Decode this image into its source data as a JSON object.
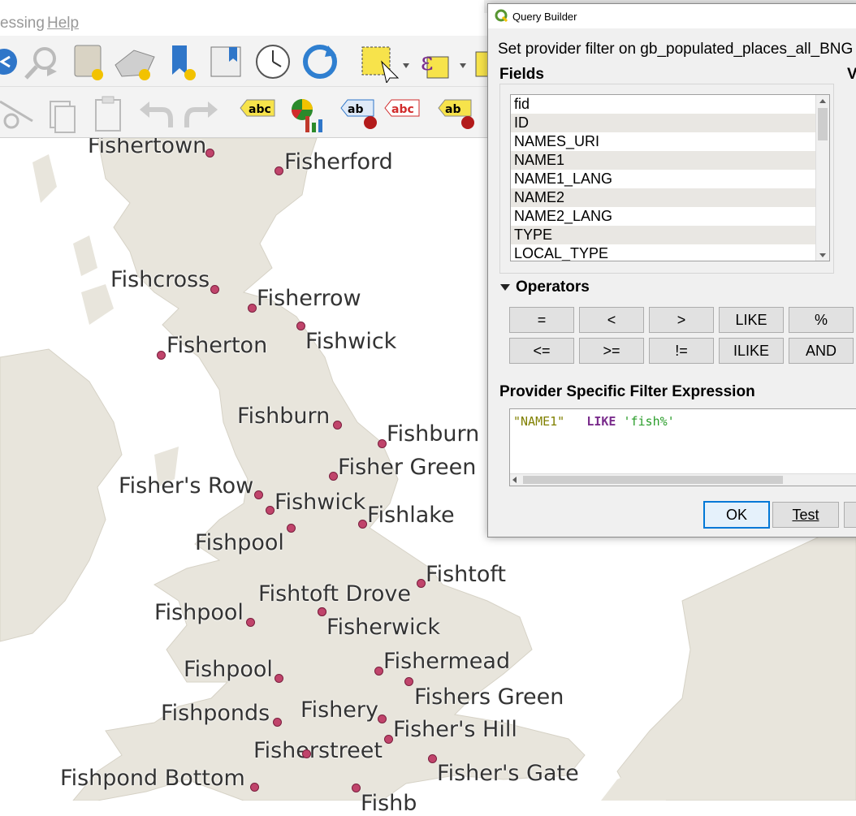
{
  "menubar": {
    "items": [
      "essing",
      "Help"
    ]
  },
  "toolbar1": {
    "icons": [
      "pan-back-icon",
      "zoom-next-icon",
      "new-layer-icon",
      "mesh-layer-icon",
      "bookmark-icon",
      "show-bookmarks-icon",
      "temporal-clock-icon",
      "refresh-icon",
      "select-features-icon",
      "expression-select-icon",
      "select-partial-icon"
    ]
  },
  "toolbar2": {
    "icons": [
      "cut-icon",
      "copy-icon",
      "paste-icon",
      "undo-icon",
      "redo-icon",
      "label-abc-icon",
      "diagram-icon",
      "pin-label-icon",
      "highlight-label-icon",
      "move-label-icon"
    ]
  },
  "map": {
    "places": [
      {
        "name": "Fishertown"
      },
      {
        "name": "Fisherford"
      },
      {
        "name": "Fishcross"
      },
      {
        "name": "Fisherrow"
      },
      {
        "name": "Fisherton"
      },
      {
        "name": "Fishwick"
      },
      {
        "name": "Fishburn"
      },
      {
        "name": "Fishburn"
      },
      {
        "name": "Fisher Green"
      },
      {
        "name": "Fisher's Row"
      },
      {
        "name": "Fishwick"
      },
      {
        "name": "Fishlake"
      },
      {
        "name": "Fishpool"
      },
      {
        "name": "Fishtoft"
      },
      {
        "name": "Fishtoft Drove"
      },
      {
        "name": "Fishpool"
      },
      {
        "name": "Fisherwick"
      },
      {
        "name": "Fishermead"
      },
      {
        "name": "Fishpool"
      },
      {
        "name": "Fishers Green"
      },
      {
        "name": "Fishery"
      },
      {
        "name": "Fishponds"
      },
      {
        "name": "Fisher's Hill"
      },
      {
        "name": "Fisherstreet"
      },
      {
        "name": "Fisher's Gate"
      },
      {
        "name": "Fishpond Bottom"
      },
      {
        "name": "Fishb"
      }
    ],
    "land_color": "#e8e5dc",
    "dot_color": "#c0446b"
  },
  "dialog": {
    "title": "Query Builder",
    "subtitle": "Set provider filter on gb_populated_places_all_BNG",
    "fields_header": "Fields",
    "values_header_fragment": "V",
    "fields": [
      "fid",
      "ID",
      "NAMES_URI",
      "NAME1",
      "NAME1_LANG",
      "NAME2",
      "NAME2_LANG",
      "TYPE",
      "LOCAL_TYPE"
    ],
    "operators_header": "Operators",
    "operators_row1": [
      "=",
      "<",
      ">",
      "LIKE",
      "%"
    ],
    "operators_row2": [
      "<=",
      ">=",
      "!=",
      "ILIKE",
      "AND"
    ],
    "expression_header": "Provider Specific Filter Expression",
    "expression": {
      "field": "\"NAME1\"",
      "op": "LIKE",
      "value": "'fish%'"
    },
    "buttons": {
      "ok": "OK",
      "test": "Test"
    }
  }
}
